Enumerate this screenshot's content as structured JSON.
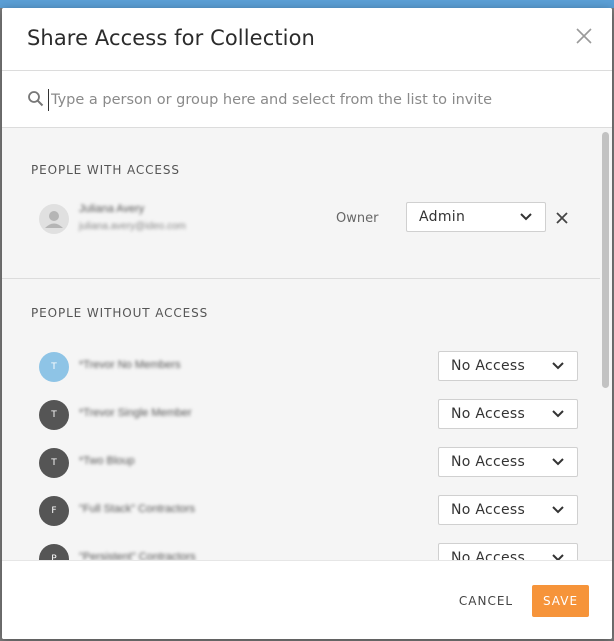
{
  "dialog": {
    "title": "Share Access for Collection",
    "close_icon": "close-icon"
  },
  "search": {
    "placeholder": "Type a person or group here and select from the list to invite",
    "value": "",
    "icon": "search-icon"
  },
  "with_access": {
    "heading": "PEOPLE WITH ACCESS",
    "members": [
      {
        "name": "Juliana Avery",
        "email": "juliana.avery@ideo.com",
        "role": "Owner",
        "access": "Admin",
        "avatar_style": "placeholder"
      }
    ]
  },
  "without_access": {
    "heading": "PEOPLE WITHOUT ACCESS",
    "members": [
      {
        "initial": "T",
        "name": "*Trevor No Members",
        "access": "No Access",
        "avatar_color": "#8ec4e6"
      },
      {
        "initial": "T",
        "name": "*Trevor Single Member",
        "access": "No Access",
        "avatar_color": "#555555"
      },
      {
        "initial": "T",
        "name": "*Two Bloup",
        "access": "No Access",
        "avatar_color": "#555555"
      },
      {
        "initial": "F",
        "name": "\"Full Stack\" Contractors",
        "access": "No Access",
        "avatar_color": "#555555"
      },
      {
        "initial": "P",
        "name": "\"Persistent\" Contractors",
        "access": "No Access",
        "avatar_color": "#555555"
      }
    ]
  },
  "footer": {
    "cancel_label": "CANCEL",
    "save_label": "SAVE"
  },
  "colors": {
    "accent": "#f6943a",
    "header_strip": "#5b9fd6"
  }
}
